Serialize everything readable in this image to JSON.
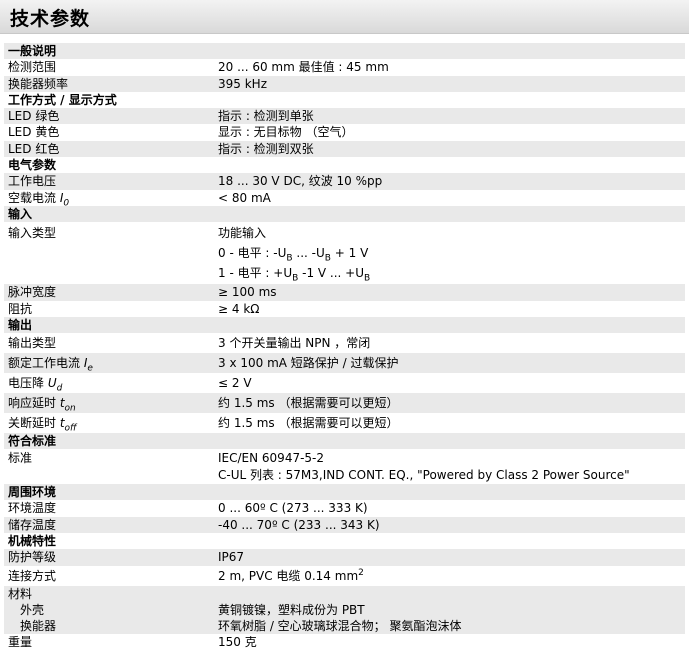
{
  "title": "技术参数",
  "general": {
    "section": "一般说明",
    "range_label": "检测范围",
    "range_value": "20 ... 60 mm 最佳值 : 45 mm",
    "freq_label": "换能器频率",
    "freq_value": "395 kHz"
  },
  "mode": {
    "section": "工作方式 / 显示方式",
    "green_label": "LED 绿色",
    "green_value": "指示 : 检测到单张",
    "yellow_label": "LED 黄色",
    "yellow_value": "显示 : 无目标物 （空气）",
    "red_label": "LED 红色",
    "red_value": "指示 : 检测到双张"
  },
  "electrical": {
    "section": "电气参数",
    "voltage_label": "工作电压",
    "voltage_value": "18 ... 30 V DC, 纹波 10 %pp",
    "current_label_pre": "空载电流 ",
    "current_symbol": "I",
    "current_sub": "0",
    "current_value": "< 80 mA"
  },
  "input": {
    "section": "输入",
    "type_label": "输入类型",
    "type_line1": "功能输入",
    "type_line2_a": "0 - 电平 : -U",
    "type_line2_b": "B",
    "type_line2_c": " ... -U",
    "type_line2_d": "B",
    "type_line2_e": " + 1 V",
    "type_line3_a": "1 - 电平 : +U",
    "type_line3_b": "B",
    "type_line3_c": " -1 V ... +U",
    "type_line3_d": "B",
    "pulse_label": "脉冲宽度",
    "pulse_value": "≥ 100 ms",
    "impedance_label": "阻抗",
    "impedance_value": "≥ 4 kΩ"
  },
  "output": {
    "section": "输出",
    "type_label": "输出类型",
    "type_value": "3 个开关量输出 NPN ，常闭",
    "rated_label_pre": "额定工作电流 ",
    "rated_symbol": "I",
    "rated_sub": "e",
    "rated_value": "3 x 100 mA 短路保护 / 过载保护",
    "drop_label_pre": "电压降 ",
    "drop_symbol": "U",
    "drop_sub": "d",
    "drop_value": "≤ 2 V",
    "on_label_pre": "响应延时 ",
    "on_symbol": "t",
    "on_sub": "on",
    "on_value": "约 1.5 ms （根据需要可以更短）",
    "off_label_pre": "关断延时 ",
    "off_symbol": "t",
    "off_sub": "off",
    "off_value": "约 1.5 ms （根据需要可以更短）"
  },
  "conformity": {
    "section": "符合标准",
    "label": "标准",
    "line1": "IEC/EN 60947-5-2",
    "line2": "C-UL 列表 : 57M3,IND CONT. EQ., \"Powered by Class 2 Power Source\""
  },
  "ambient": {
    "section": "周围环境",
    "temp_label": "环境温度",
    "temp_value": "0 ... 60º C (273 ... 333 K)",
    "storage_label": "储存温度",
    "storage_value": "-40 ... 70º C (233 ... 343 K)"
  },
  "mechanical": {
    "section": "机械特性",
    "protection_label": "防护等级",
    "protection_value": "IP67",
    "connection_label": "连接方式",
    "connection_value": "2 m, PVC 电缆 0.14 mm",
    "connection_sup": "2",
    "material_label": "材料",
    "housing_label": "外壳",
    "housing_value": "黄铜镀镍，塑料成份为 PBT",
    "transducer_label": "换能器",
    "transducer_value": "环氧树脂 / 空心玻璃球混合物； 聚氨酯泡沫体",
    "weight_label": "重量",
    "weight_value": "150 克"
  }
}
